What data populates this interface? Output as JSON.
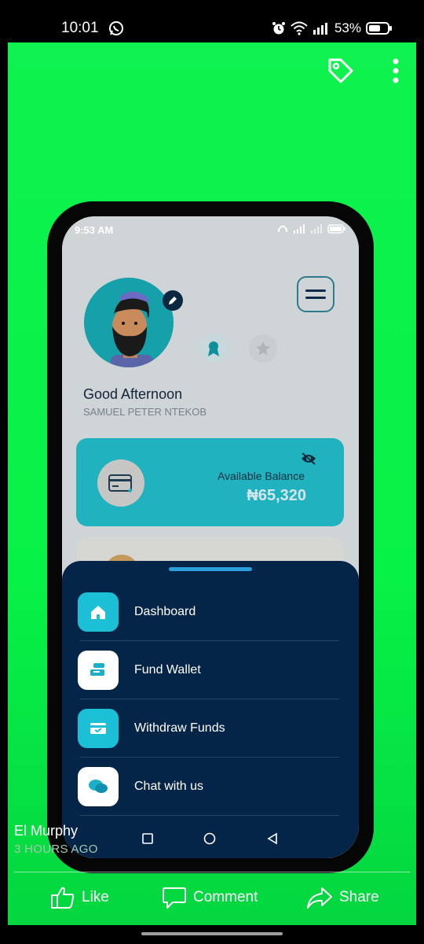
{
  "status_bar": {
    "time": "10:01",
    "battery": "53%"
  },
  "phone": {
    "status_time": "9:53 AM",
    "greeting": "Good Afternoon",
    "username": "SAMUEL PETER NTEKOB",
    "balance_label": "Available Balance",
    "balance_value": "₦65,320",
    "menu": [
      {
        "label": "Dashboard",
        "icon": "home-icon"
      },
      {
        "label": "Fund Wallet",
        "icon": "wallet-icon"
      },
      {
        "label": "Withdraw Funds",
        "icon": "card-icon"
      },
      {
        "label": "Chat with us",
        "icon": "chat-icon"
      }
    ]
  },
  "story": {
    "author": "El Murphy",
    "time_ago": "3 HOURS AGO"
  },
  "actions": {
    "like": "Like",
    "comment": "Comment",
    "share": "Share"
  },
  "colors": {
    "story_bg": "#07f247",
    "sheet_bg": "#052548",
    "card_teal": "#20b3bf"
  }
}
